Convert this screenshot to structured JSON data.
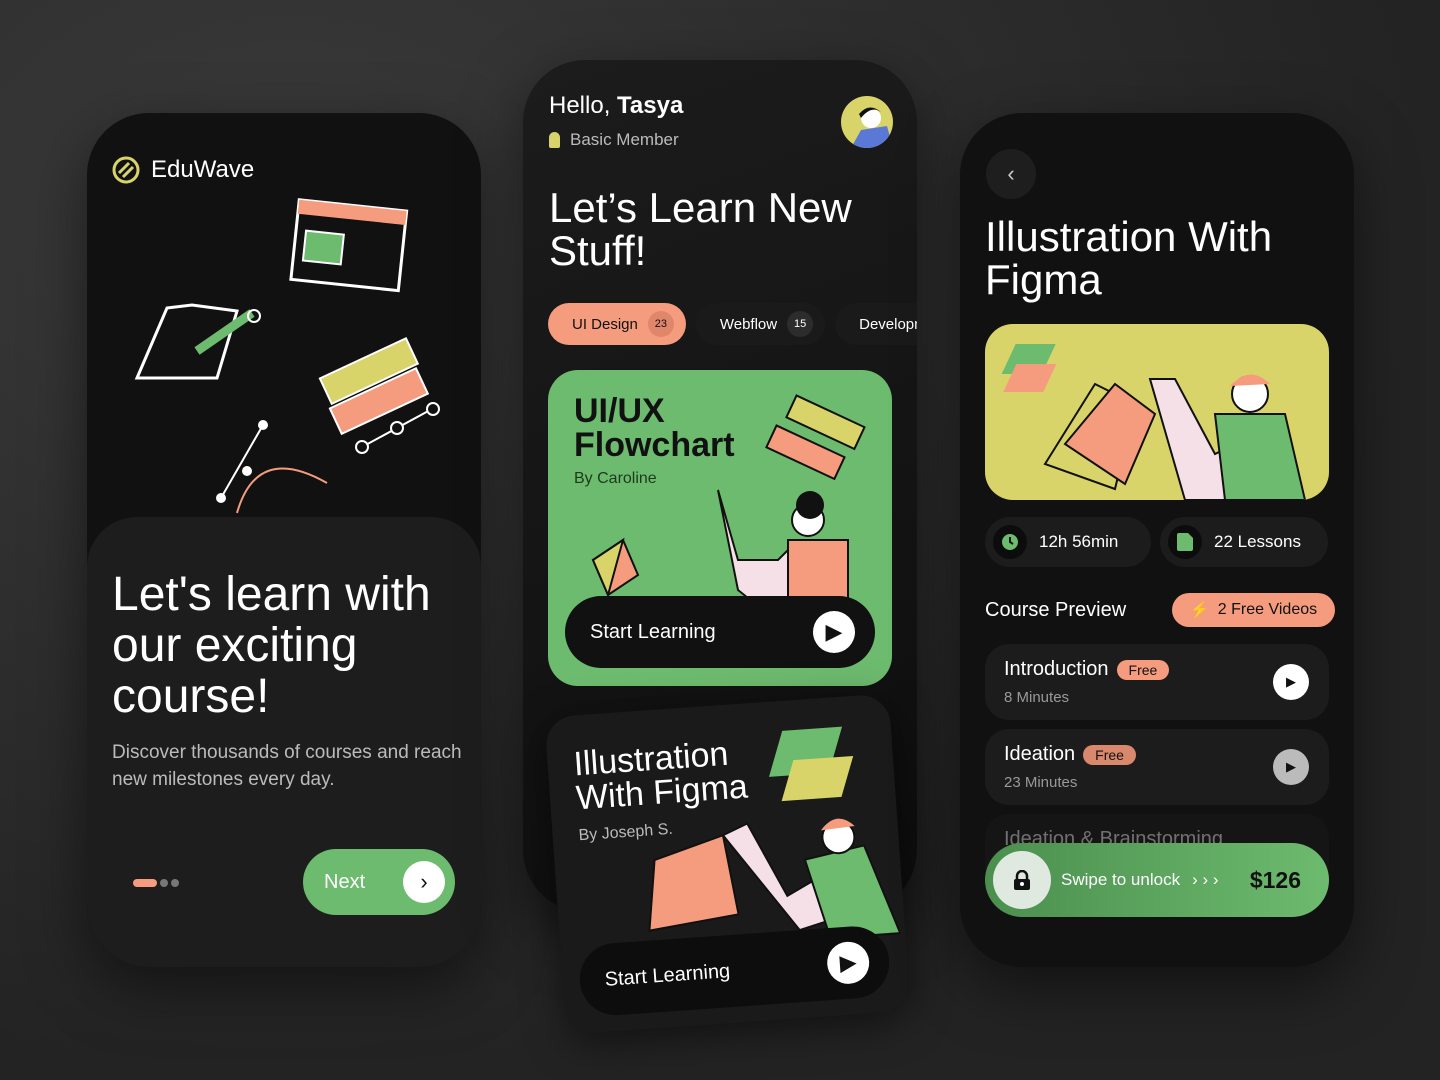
{
  "colors": {
    "green": "#6dbb6f",
    "salmon": "#f59c7e",
    "yellow": "#d8d46a",
    "background": "#111111"
  },
  "onboarding": {
    "brand": "EduWave",
    "title": "Let's learn with our exciting course!",
    "subtitle": "Discover thousands of courses and reach new milestones every day.",
    "next_label": "Next",
    "page_index": 1,
    "page_count": 3
  },
  "home": {
    "greeting": "Hello,",
    "user_name": "Tasya",
    "membership": "Basic Member",
    "title": "Let’s Learn New Stuff!",
    "categories": [
      {
        "label": "UI Design",
        "count": "23",
        "active": true
      },
      {
        "label": "Webflow",
        "count": "15"
      },
      {
        "label": "Development"
      }
    ],
    "courses": [
      {
        "title": "UI/UX Flowchart",
        "author": "By Caroline",
        "cta": "Start Learning"
      },
      {
        "title": "Illustration With Figma",
        "author": "By Joseph S.",
        "cta": "Start Learning"
      }
    ]
  },
  "detail": {
    "title": "Illustration With Figma",
    "duration": "12h 56min",
    "lessons_count": "22 Lessons",
    "preview_label": "Course Preview",
    "free_videos": "2 Free Videos",
    "lessons": [
      {
        "title": "Introduction",
        "badge": "Free",
        "duration": "8 Minutes"
      },
      {
        "title": "Ideation",
        "badge": "Free",
        "duration": "23 Minutes"
      },
      {
        "title": "Ideation & Brainstorming"
      }
    ],
    "swipe_label": "Swipe to unlock",
    "price": "$126"
  }
}
